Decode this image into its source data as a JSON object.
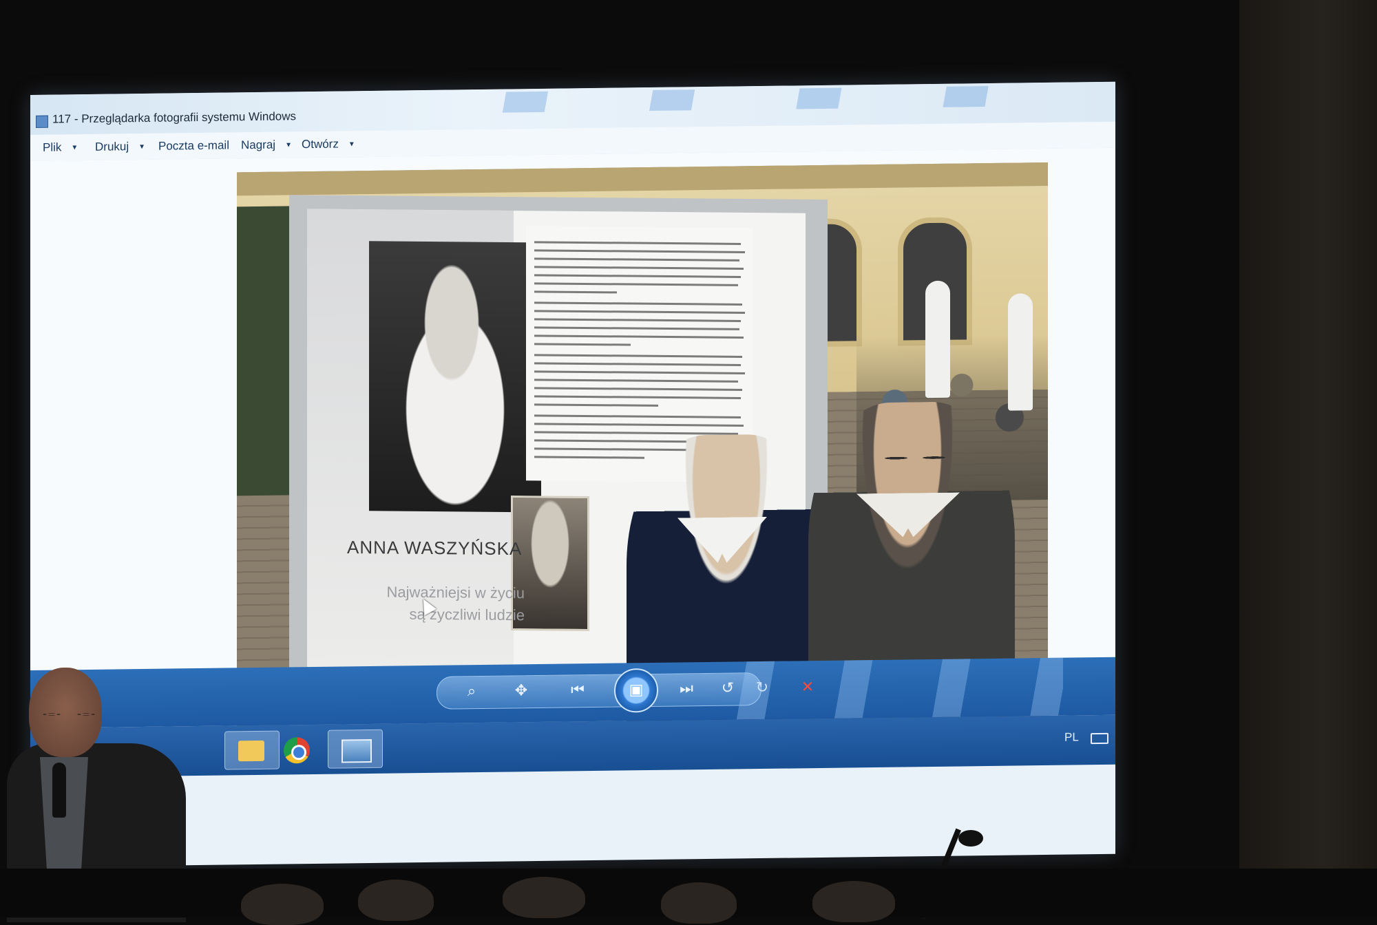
{
  "window": {
    "title": "117 - Przeglądarka fotografii systemu Windows"
  },
  "menu": {
    "items": [
      {
        "label": "Plik",
        "has_dropdown": true
      },
      {
        "label": "Drukuj",
        "has_dropdown": true
      },
      {
        "label": "Poczta e-mail",
        "has_dropdown": false
      },
      {
        "label": "Nagraj",
        "has_dropdown": true
      },
      {
        "label": "Otwórz",
        "has_dropdown": true
      }
    ]
  },
  "photo": {
    "board_name": "ANNA WASZYŃSKA",
    "board_quote_line1": "Najważniejsi w życiu",
    "board_quote_line2": "są życzliwi ludzie"
  },
  "controls": {
    "zoom_icon": "magnifier-icon",
    "fit_icon": "actual-size-icon",
    "previous_icon": "previous-icon",
    "slideshow_icon": "slideshow-icon",
    "next_icon": "next-icon",
    "rotate_left_icon": "rotate-ccw-icon",
    "rotate_right_icon": "rotate-cw-icon",
    "delete_icon": "delete-icon"
  },
  "taskbar": {
    "apps": [
      "explorer",
      "chrome",
      "photo-viewer"
    ],
    "language": "PL"
  },
  "colors": {
    "control_bar": "#2c6fb8",
    "menu_text": "#1a3b63",
    "delete": "#ff4a3a"
  }
}
